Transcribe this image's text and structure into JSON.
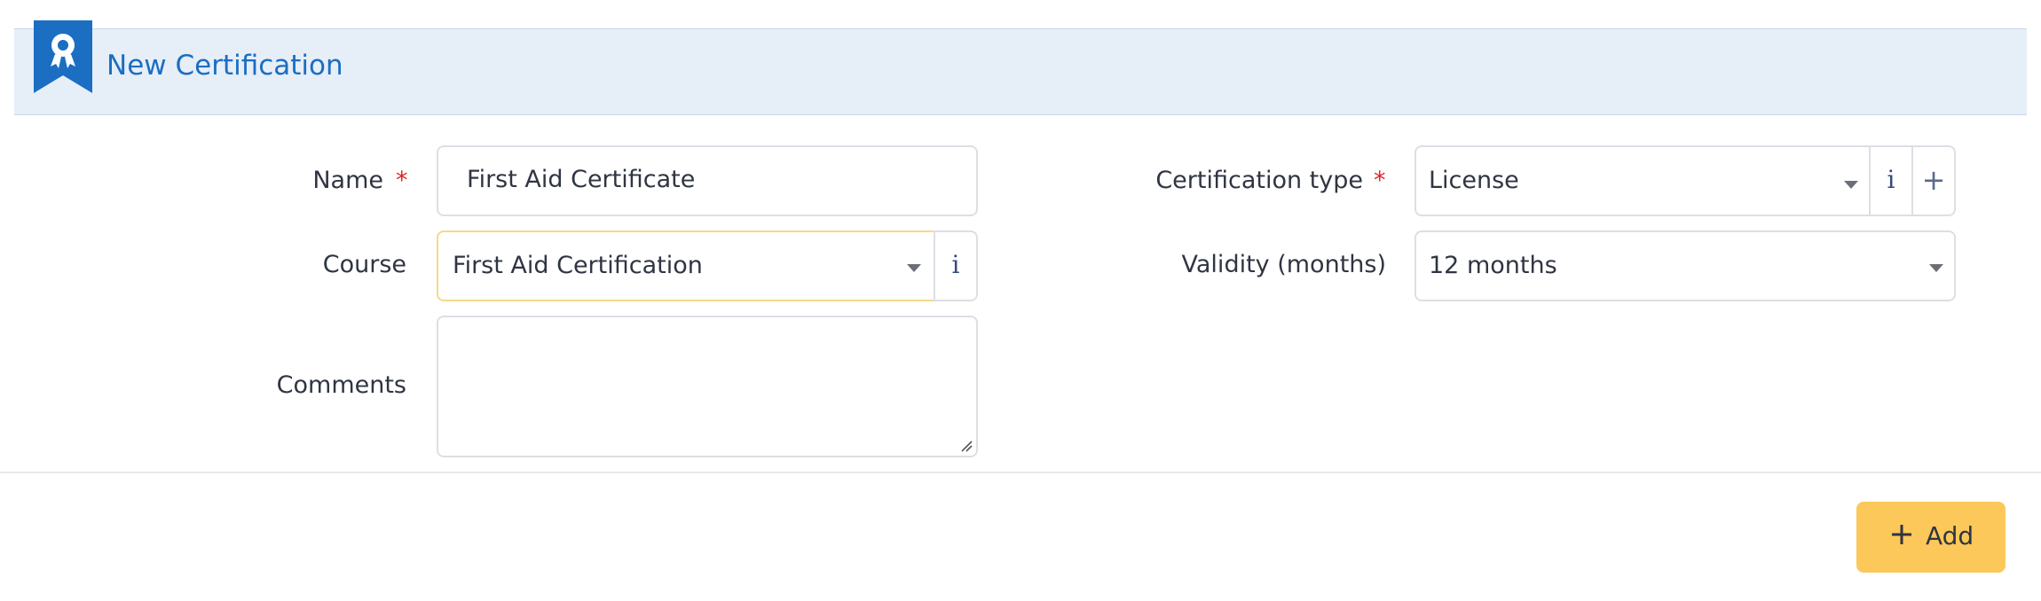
{
  "header": {
    "title": "New Certification",
    "icon": "certificate-ribbon-icon",
    "accent_color": "#1b6ec2"
  },
  "form": {
    "name": {
      "label": "Name",
      "required_marker": "*",
      "value": "First Aid Certificate"
    },
    "course": {
      "label": "Course",
      "value": "First Aid Certification",
      "info_label": "i"
    },
    "comments": {
      "label": "Comments",
      "value": ""
    },
    "certification_type": {
      "label": "Certification type",
      "required_marker": "*",
      "value": "License",
      "info_label": "i",
      "add_label": "+"
    },
    "validity": {
      "label": "Validity (months)",
      "value": "12 months"
    }
  },
  "actions": {
    "add_label": "Add",
    "add_color": "#fcc85a"
  },
  "colors": {
    "required": "#e02424",
    "header_bg": "#e6eef8"
  }
}
